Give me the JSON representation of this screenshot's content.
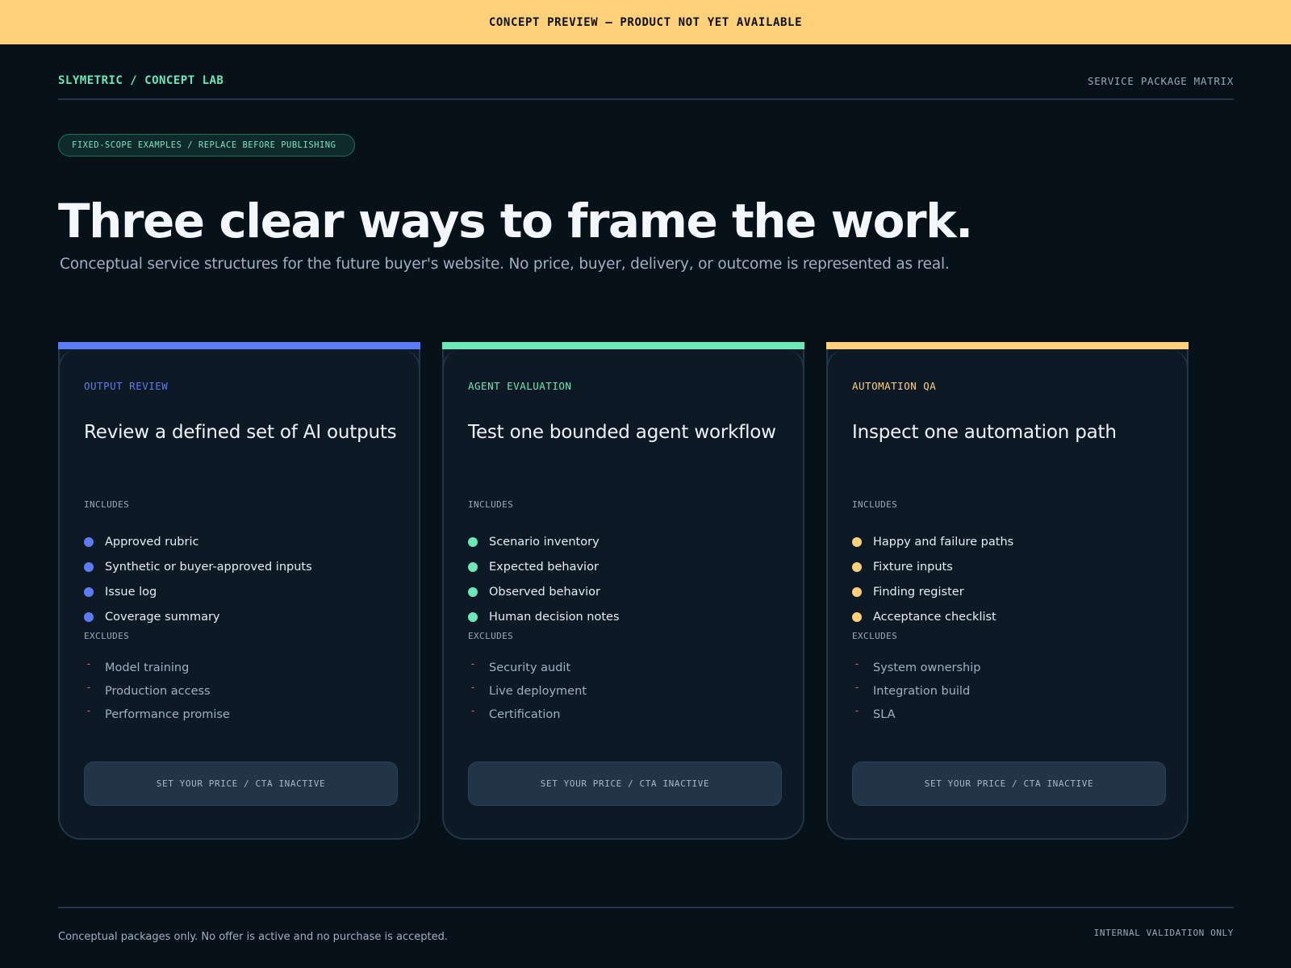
{
  "banner": {
    "text": "CONCEPT PREVIEW — PRODUCT NOT YET AVAILABLE"
  },
  "header": {
    "brand": "SLYMETRIC / CONCEPT LAB",
    "right_label": "SERVICE PACKAGE MATRIX"
  },
  "hero": {
    "pill": "FIXED-SCOPE EXAMPLES / REPLACE BEFORE PUBLISHING",
    "title": "Three clear ways to frame the work.",
    "subtitle": "Conceptual service structures for the future buyer's website. No price, buyer, delivery, or outcome is represented as real."
  },
  "colors": {
    "blue": "#5b7cf5",
    "green": "#6ee7b7",
    "amber": "#ffd07a",
    "dash": "#f0607a"
  },
  "cards": [
    {
      "label": "OUTPUT REVIEW",
      "title": "Review a defined set of AI outputs",
      "includes_heading": "INCLUDES",
      "includes": [
        "Approved rubric",
        "Synthetic or buyer-approved inputs",
        "Issue log",
        "Coverage summary"
      ],
      "excludes_heading": "EXCLUDES",
      "excludes": [
        "Model training",
        "Production access",
        "Performance promise"
      ],
      "cta": "SET YOUR PRICE / CTA INACTIVE"
    },
    {
      "label": "AGENT EVALUATION",
      "title": "Test one bounded agent workflow",
      "includes_heading": "INCLUDES",
      "includes": [
        "Scenario inventory",
        "Expected behavior",
        "Observed behavior",
        "Human decision notes"
      ],
      "excludes_heading": "EXCLUDES",
      "excludes": [
        "Security audit",
        "Live deployment",
        "Certification"
      ],
      "cta": "SET YOUR PRICE / CTA INACTIVE"
    },
    {
      "label": "AUTOMATION QA",
      "title": "Inspect one automation path",
      "includes_heading": "INCLUDES",
      "includes": [
        "Happy and failure paths",
        "Fixture inputs",
        "Finding register",
        "Acceptance checklist"
      ],
      "excludes_heading": "EXCLUDES",
      "excludes": [
        "System ownership",
        "Integration build",
        "SLA"
      ],
      "cta": "SET YOUR PRICE / CTA INACTIVE"
    }
  ],
  "footer": {
    "note": "Conceptual packages only. No offer is active and no purchase is accepted.",
    "right_label": "INTERNAL VALIDATION ONLY"
  }
}
